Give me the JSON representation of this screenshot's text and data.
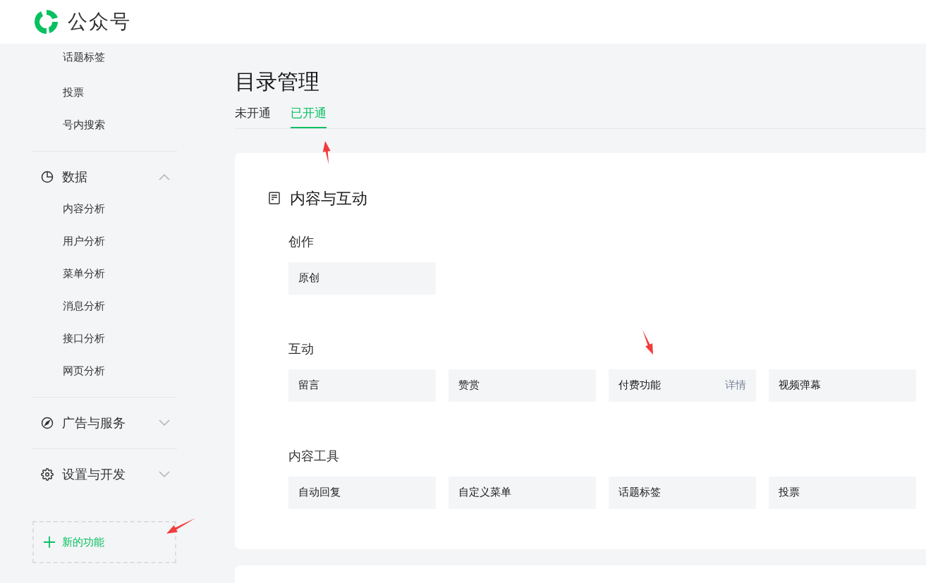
{
  "header": {
    "brand": "公众号"
  },
  "sidebar": {
    "groups": [
      {
        "kind": "continued",
        "items": [
          "话题标签",
          "投票",
          "号内搜索"
        ]
      },
      {
        "kind": "chart",
        "label": "数据",
        "expanded": true,
        "items": [
          "内容分析",
          "用户分析",
          "菜单分析",
          "消息分析",
          "接口分析",
          "网页分析"
        ]
      },
      {
        "kind": "compass",
        "label": "广告与服务",
        "expanded": false
      },
      {
        "kind": "gear",
        "label": "设置与开发",
        "expanded": false
      }
    ],
    "new_feature": "新的功能"
  },
  "page": {
    "title": "目录管理",
    "tabs": [
      {
        "label": "未开通",
        "selected": false
      },
      {
        "label": "已开通",
        "selected": true
      }
    ]
  },
  "card": {
    "title": "内容与互动",
    "sections": [
      {
        "title": "创作",
        "tiles": [
          {
            "label": "原创"
          }
        ]
      },
      {
        "title": "互动",
        "tiles": [
          {
            "label": "留言"
          },
          {
            "label": "赞赏"
          },
          {
            "label": "付费功能",
            "detail": "详情"
          },
          {
            "label": "视频弹幕"
          }
        ]
      },
      {
        "title": "内容工具",
        "tiles": [
          {
            "label": "自动回复"
          },
          {
            "label": "自定义菜单"
          },
          {
            "label": "话题标签"
          },
          {
            "label": "投票"
          }
        ]
      }
    ]
  }
}
